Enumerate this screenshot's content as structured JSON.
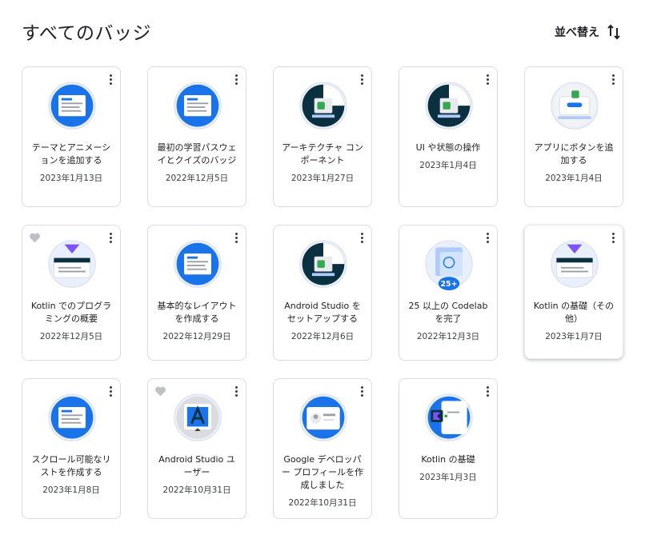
{
  "header": {
    "title": "すべてのバッジ",
    "sort_label": "並べ替え",
    "sort_icon": "sort-arrows-icon"
  },
  "badges": [
    {
      "title": "テーマとアニメーションを追加する",
      "date": "2023年1月13日",
      "favorite": false,
      "art": "blue"
    },
    {
      "title": "最初の学習パスウェイとクイズのバッジ",
      "date": "2022年12月5日",
      "favorite": false,
      "art": "blue"
    },
    {
      "title": "アーキテクチャ コンポーネント",
      "date": "2023年1月27日",
      "favorite": false,
      "art": "dark"
    },
    {
      "title": "UI や状態の操作",
      "date": "2023年1月4日",
      "favorite": false,
      "art": "dark"
    },
    {
      "title": "アプリにボタンを追加する",
      "date": "2023年1月4日",
      "favorite": false,
      "art": "light"
    },
    {
      "title": "Kotlin でのプログラミングの概要",
      "date": "2022年12月5日",
      "favorite": true,
      "art": "kotlin"
    },
    {
      "title": "基本的なレイアウトを作成する",
      "date": "2022年12月29日",
      "favorite": false,
      "art": "blue"
    },
    {
      "title": "Android Studio をセットアップする",
      "date": "2022年12月6日",
      "favorite": false,
      "art": "dark"
    },
    {
      "title": "25 以上の Codelab を完了",
      "date": "2022年12月3日",
      "favorite": false,
      "art": "codelab",
      "counter": "25+"
    },
    {
      "title": "Kotlin の基礎（その他）",
      "date": "2023年1月7日",
      "favorite": false,
      "art": "kotlin"
    },
    {
      "title": "スクロール可能なリストを作成する",
      "date": "2023年1月8日",
      "favorite": false,
      "art": "blue"
    },
    {
      "title": "Android Studio ユーザー",
      "date": "2022年10月31日",
      "favorite": true,
      "art": "studio"
    },
    {
      "title": "Google デベロッパー プロフィールを作成しました",
      "date": "2022年10月31日",
      "favorite": false,
      "art": "profile"
    },
    {
      "title": "Kotlin の基礎",
      "date": "2023年1月3日",
      "favorite": false,
      "art": "kotlin2"
    }
  ],
  "colors": {
    "google_blue": "#1a73e8",
    "dark_teal": "#0b3040",
    "android_green": "#34a853",
    "heart_gray": "#bdc1c6",
    "kotlin_purple": "#7f52ff"
  }
}
